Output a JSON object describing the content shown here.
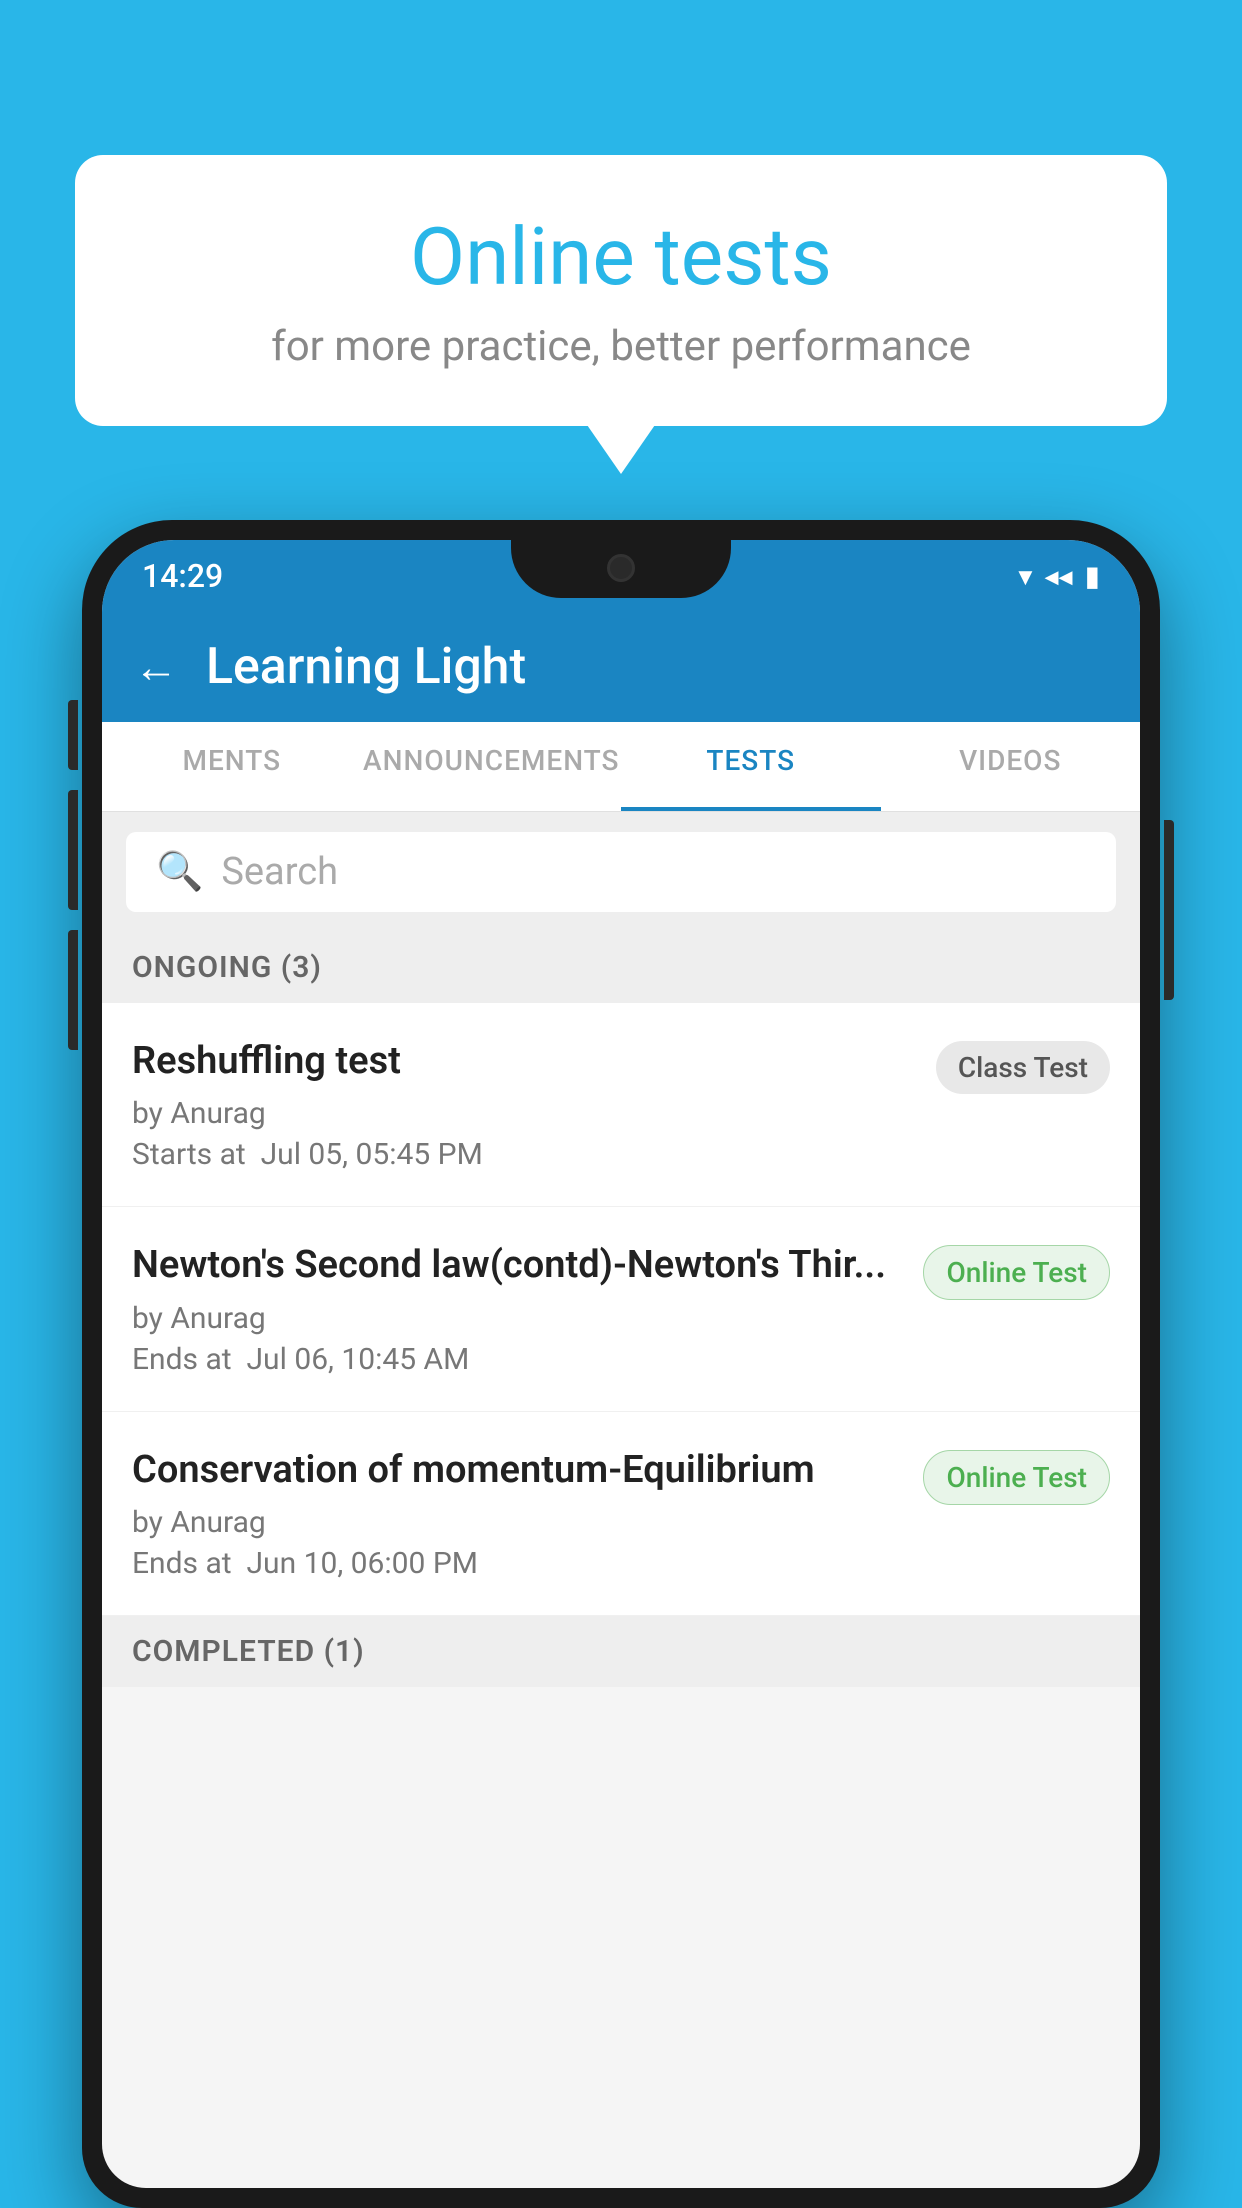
{
  "background": {
    "color": "#29b6e8"
  },
  "bubble": {
    "title": "Online tests",
    "subtitle": "for more practice, better performance"
  },
  "phone": {
    "status_bar": {
      "time": "14:29",
      "wifi_icon": "▼",
      "signal_icon": "◀",
      "battery_icon": "▮"
    },
    "app_bar": {
      "back_label": "←",
      "title": "Learning Light"
    },
    "tabs": [
      {
        "label": "MENTS",
        "active": false
      },
      {
        "label": "ANNOUNCEMENTS",
        "active": false
      },
      {
        "label": "TESTS",
        "active": true
      },
      {
        "label": "VIDEOS",
        "active": false
      }
    ],
    "search": {
      "placeholder": "Search"
    },
    "ongoing_section": {
      "label": "ONGOING (3)"
    },
    "tests": [
      {
        "title": "Reshuffling test",
        "author": "by Anurag",
        "time_label": "Starts at",
        "time": "Jul 05, 05:45 PM",
        "badge": "Class Test",
        "badge_type": "class"
      },
      {
        "title": "Newton's Second law(contd)-Newton's Thir...",
        "author": "by Anurag",
        "time_label": "Ends at",
        "time": "Jul 06, 10:45 AM",
        "badge": "Online Test",
        "badge_type": "online"
      },
      {
        "title": "Conservation of momentum-Equilibrium",
        "author": "by Anurag",
        "time_label": "Ends at",
        "time": "Jun 10, 06:00 PM",
        "badge": "Online Test",
        "badge_type": "online"
      }
    ],
    "completed_section": {
      "label": "COMPLETED (1)"
    }
  }
}
